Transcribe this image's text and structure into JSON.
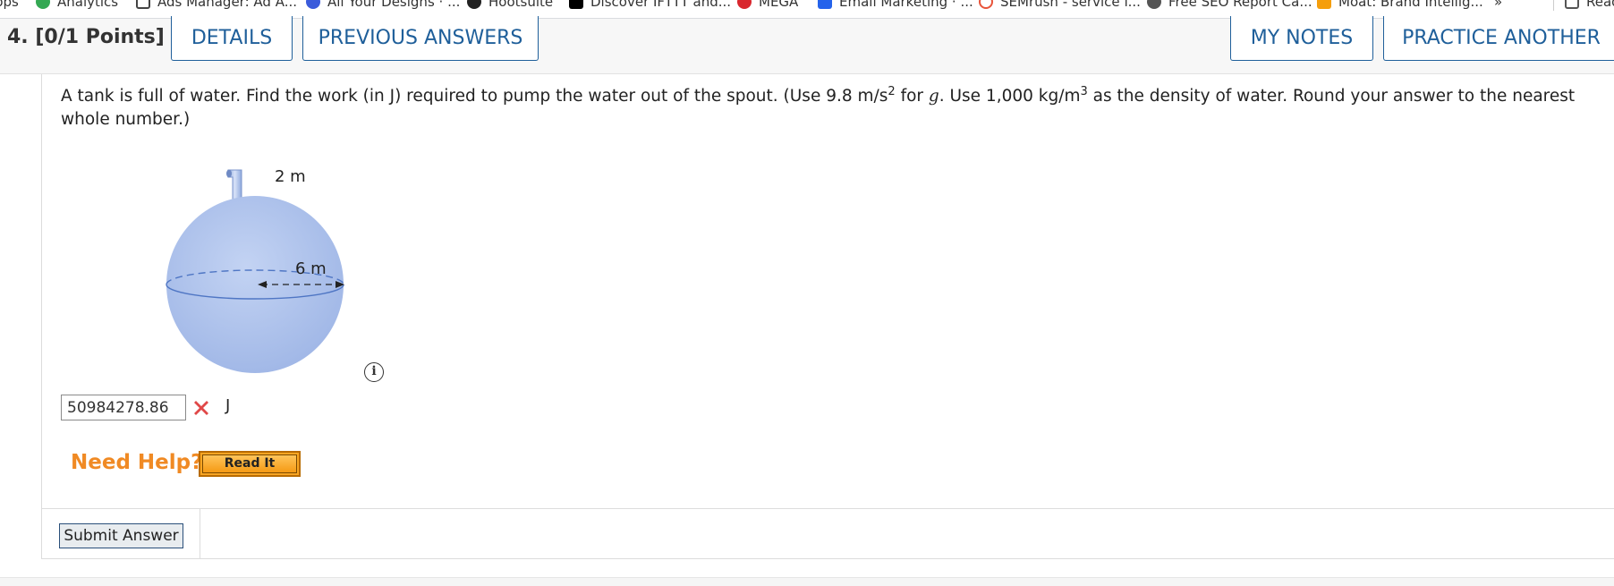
{
  "bookmarks": [
    {
      "label": "pps",
      "icon": "apps-icon",
      "color": "#666666"
    },
    {
      "label": "Analytics",
      "icon": "analytics-icon",
      "color": "#34a853"
    },
    {
      "label": "Ads Manager: Ad A...",
      "icon": "ads-manager-icon",
      "color": "#444444"
    },
    {
      "label": "All Your Designs · ...",
      "icon": "canva-icon",
      "color": "#3b5bdb"
    },
    {
      "label": "Hootsuite",
      "icon": "hootsuite-icon",
      "color": "#222222"
    },
    {
      "label": "Discover IFTTT and...",
      "icon": "ifttt-icon",
      "color": "#000000"
    },
    {
      "label": "MEGA",
      "icon": "mega-icon",
      "color": "#d9272e"
    },
    {
      "label": "Email Marketing · ...",
      "icon": "email-marketing-icon",
      "color": "#2563eb"
    },
    {
      "label": "SEMrush - service f...",
      "icon": "semrush-icon",
      "color": "#e8543a"
    },
    {
      "label": "Free SEO Report Ca...",
      "icon": "seo-report-icon",
      "color": "#555555"
    },
    {
      "label": "Moat: Brand Intellig...",
      "icon": "moat-icon",
      "color": "#f59e0b"
    },
    {
      "label": "»",
      "icon": "more-bookmarks-icon",
      "color": "#555555"
    },
    {
      "label": "Read",
      "icon": "reading-list-icon",
      "color": "#555555"
    }
  ],
  "header": {
    "question_number": "4.",
    "points": "[0/1 Points]",
    "details_label": "DETAILS",
    "previous_answers_label": "PREVIOUS ANSWERS",
    "my_notes_label": "MY NOTES",
    "practice_another_label": "PRACTICE ANOTHER"
  },
  "question": {
    "text_1": "A tank is full of water. Find the work (in J) required to pump the water out of the spout. (Use 9.8 m/s",
    "sup_1": "2",
    "text_2": " for ",
    "var_g": "g",
    "text_3": ". Use 1,000 kg/m",
    "sup_2": "3",
    "text_4": " as the density of water. Round your answer to the nearest whole number.)"
  },
  "figure": {
    "spout_label": "2 m",
    "radius_label": "6 m",
    "sphere_color": "#a9bfea",
    "accent_color": "#5a7fc8"
  },
  "answer": {
    "value": "50984278.86",
    "status": "incorrect",
    "unit": "J"
  },
  "help": {
    "need_help_label": "Need Help?",
    "read_it_label": "Read It"
  },
  "submit_label": "Submit Answer",
  "colors": {
    "link_blue": "#1f5f9a",
    "help_orange": "#f08a24",
    "wrong_red": "#e04848"
  }
}
